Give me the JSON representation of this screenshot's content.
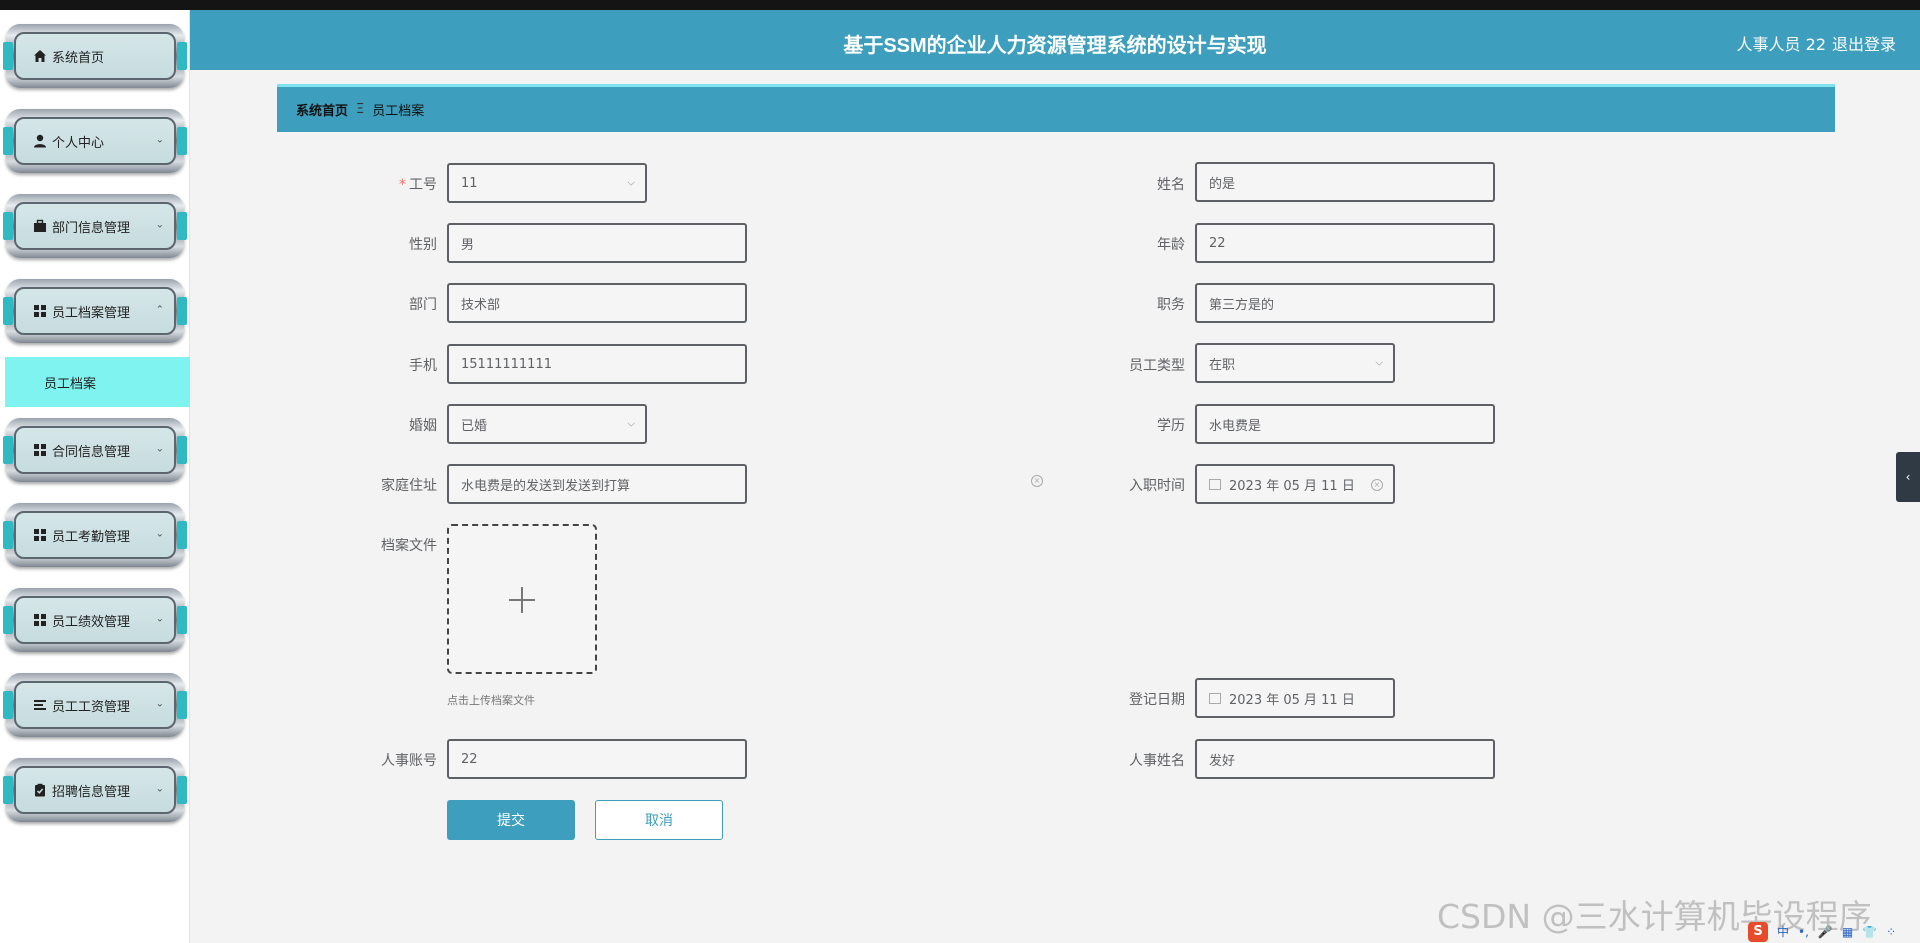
{
  "header": {
    "title": "基于SSM的企业人力资源管理系统的设计与实现",
    "user": "人事人员 22",
    "logout": "退出登录"
  },
  "sidebar": {
    "items": [
      {
        "label": "系统首页",
        "icon": "home-icon"
      },
      {
        "label": "个人中心",
        "icon": "user-icon"
      },
      {
        "label": "部门信息管理",
        "icon": "briefcase-icon"
      },
      {
        "label": "员工档案管理",
        "icon": "grid-icon",
        "expanded": true
      },
      {
        "label": "合同信息管理",
        "icon": "grid-icon"
      },
      {
        "label": "员工考勤管理",
        "icon": "grid-icon"
      },
      {
        "label": "员工绩效管理",
        "icon": "grid-icon"
      },
      {
        "label": "员工工资管理",
        "icon": "list-icon"
      },
      {
        "label": "招聘信息管理",
        "icon": "clipboard-icon"
      }
    ],
    "active_sub": "员工档案"
  },
  "breadcrumb": {
    "home": "系统首页",
    "separator": "Ξ",
    "current": "员工档案"
  },
  "form": {
    "gonghao": {
      "label": "工号",
      "value": "11",
      "required": true
    },
    "xingming": {
      "label": "姓名",
      "value": "的是"
    },
    "xingbie": {
      "label": "性别",
      "value": "男"
    },
    "nianling": {
      "label": "年龄",
      "value": "22"
    },
    "bumen": {
      "label": "部门",
      "value": "技术部"
    },
    "zhiwu": {
      "label": "职务",
      "value": "第三方是的"
    },
    "shouji": {
      "label": "手机",
      "value": "15111111111"
    },
    "yuangongleixing": {
      "label": "员工类型",
      "value": "在职"
    },
    "hunyin": {
      "label": "婚姻",
      "value": "已婚"
    },
    "xueli": {
      "label": "学历",
      "value": "水电费是"
    },
    "jiatingzhuzhi": {
      "label": "家庭住址",
      "value": "水电费是的发送到发送到打算"
    },
    "ruzhishijian": {
      "label": "入职时间",
      "value": "2023 年 05 月 11 日"
    },
    "danganwenjian": {
      "label": "档案文件",
      "tip": "点击上传档案文件"
    },
    "dengjiriqi": {
      "label": "登记日期",
      "value": "2023 年 05 月 11 日"
    },
    "renshizhanghao": {
      "label": "人事账号",
      "value": "22"
    },
    "renshixingming": {
      "label": "人事姓名",
      "value": "发好"
    },
    "submit": "提交",
    "cancel": "取消"
  },
  "watermark": "CSDN @三水计算机毕设程序",
  "ime": {
    "logo": "S",
    "items": [
      "中",
      "•,",
      "🎤",
      "▦",
      "👕",
      "⁘"
    ]
  },
  "colors": {
    "primary": "#3d9fbd",
    "active_sub": "#7ef3ef",
    "required": "#f56c6c"
  }
}
